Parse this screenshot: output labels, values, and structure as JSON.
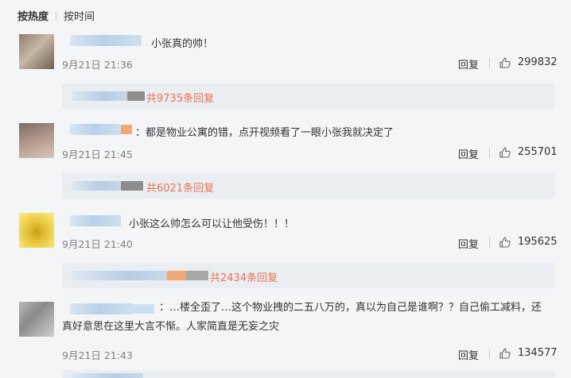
{
  "sort": {
    "active": "按热度",
    "other": "按时间"
  },
  "comments": [
    {
      "text": "小张真的帅！",
      "time": "9月21日 21:36",
      "reply": "回复",
      "likes": "299832",
      "subreplies": "共9735条回复"
    },
    {
      "text": "：都是物业公寓的错，点开视频看了一眼小张我就决定了",
      "time": "9月21日 21:45",
      "reply": "回复",
      "likes": "255701",
      "subreplies": "共6021条回复"
    },
    {
      "text": "小张这么帅怎么可以让他受伤！！！",
      "time": "9月21日 21:40",
      "reply": "回复",
      "likes": "195625",
      "subreplies": "共2434条回复"
    },
    {
      "text": "：…楼全歪了…这个物业拽的二五八万的，真以为自己是谁啊？？自己偷工减料，还真好意思在这里大言不惭。人家简直是无妄之灾",
      "time": "9月21日 21:43",
      "reply": "回复",
      "likes": "134577"
    }
  ],
  "colors": {
    "link": "#eb7350",
    "meta": "#808080",
    "background": "#f4f5f7"
  },
  "icons": {
    "like": "thumbs-up-icon"
  }
}
